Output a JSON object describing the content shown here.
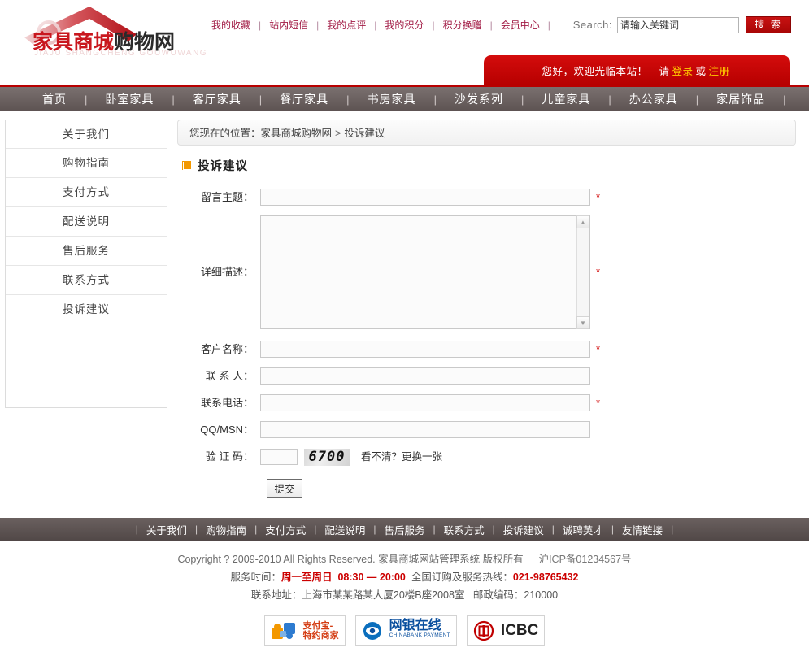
{
  "site": {
    "logo_red": "家具商城",
    "logo_dark": "购物网",
    "logo_sub": "JIAJU SHANGCHENG GOUWUWANG"
  },
  "top_links": [
    {
      "label": "我的收藏"
    },
    {
      "label": "站内短信"
    },
    {
      "label": "我的点评"
    },
    {
      "label": "我的积分"
    },
    {
      "label": "积分换赠"
    },
    {
      "label": "会员中心"
    }
  ],
  "search": {
    "label": "Search:",
    "value": "请输入关键词",
    "placeholder": "请输入关键词",
    "button": "搜 索"
  },
  "welcome": {
    "greeting": "您好，欢迎光临本站！",
    "please": "请",
    "login": "登录",
    "or": "或",
    "register": "注册"
  },
  "mainnav": [
    {
      "label": "首页"
    },
    {
      "label": "卧室家具"
    },
    {
      "label": "客厅家具"
    },
    {
      "label": "餐厅家具"
    },
    {
      "label": "书房家具"
    },
    {
      "label": "沙发系列"
    },
    {
      "label": "儿童家具"
    },
    {
      "label": "办公家具"
    },
    {
      "label": "家居饰品"
    }
  ],
  "sidebar": {
    "items": [
      {
        "label": "关于我们"
      },
      {
        "label": "购物指南"
      },
      {
        "label": "支付方式"
      },
      {
        "label": "配送说明"
      },
      {
        "label": "售后服务"
      },
      {
        "label": "联系方式"
      },
      {
        "label": "投诉建议"
      }
    ]
  },
  "breadcrumb": {
    "prefix": "您现在的位置：",
    "home": "家具商城购物网",
    "sep": ">",
    "current": "投诉建议"
  },
  "page": {
    "title": "投诉建议"
  },
  "form": {
    "subject_label": "留言主题：",
    "subject_value": "",
    "detail_label": "详细描述：",
    "detail_value": "",
    "customer_label": "客户名称：",
    "customer_value": "",
    "contact_label": "联 系 人：",
    "contact_value": "",
    "phone_label": "联系电话：",
    "phone_value": "",
    "qqmsn_label": "QQ/MSN：",
    "qqmsn_value": "",
    "captcha_label": "验 证 码：",
    "captcha_value": "",
    "captcha_code": "6700",
    "captcha_hint": "看不清？更换一张",
    "required_mark": "*",
    "submit": "提交"
  },
  "footer": {
    "links": [
      {
        "label": "关于我们"
      },
      {
        "label": "购物指南"
      },
      {
        "label": "支付方式"
      },
      {
        "label": "配送说明"
      },
      {
        "label": "售后服务"
      },
      {
        "label": "联系方式"
      },
      {
        "label": "投诉建议"
      },
      {
        "label": "诚聘英才"
      },
      {
        "label": "友情链接"
      }
    ],
    "copyright": "Copyright ? 2009-2010 All Rights Reserved. 家具商城网站管理系统 版权所有",
    "icp": "沪ICP备01234567号",
    "service_prefix": "服务时间：",
    "service_days": "周一至周日",
    "service_hours": "08:30 — 20:00",
    "hotline_prefix": "全国订购及服务热线：",
    "hotline": "021-98765432",
    "address_prefix": "联系地址：",
    "address": "上海市某某路某大厦20楼B座2008室",
    "zip_prefix": "邮政编码：",
    "zip": "210000"
  },
  "payments": [
    {
      "name": "alipay",
      "line1": "支付宝-",
      "line2": "特约商家"
    },
    {
      "name": "chinabank",
      "main": "网银在线",
      "sub": "CHINABANK PAYMENT"
    },
    {
      "name": "icbc",
      "main": "ICBC"
    }
  ],
  "colors": {
    "brand_red": "#c9171e",
    "banner_red": "#cc0000",
    "nav_gray": "#6b6160",
    "accent_orange": "#f39800"
  }
}
